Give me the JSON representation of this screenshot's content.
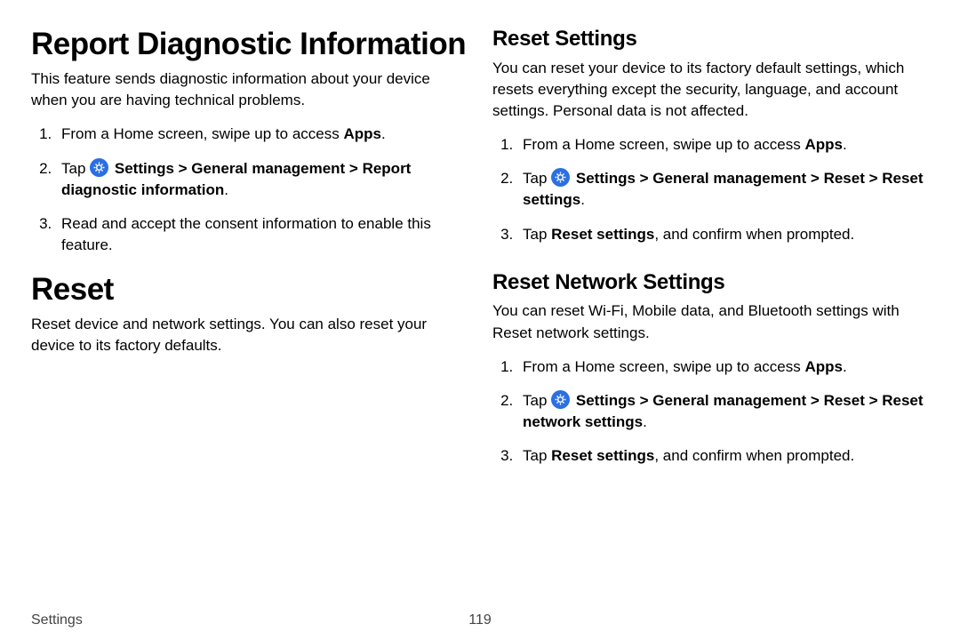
{
  "left": {
    "h1": "Report Diagnostic Information",
    "intro": "This feature sends diagnostic information about your device when you are having technical problems.",
    "steps": {
      "s1_pre": "From a Home screen, swipe up to access ",
      "s1_bold": "Apps",
      "s1_post": ".",
      "s2_pre": "Tap ",
      "s2_path": " Settings > General management > Report diagnostic information",
      "s2_post": ".",
      "s3": "Read and accept the consent information to enable this feature."
    },
    "h1b": "Reset",
    "reset_intro": "Reset device and network settings. You can also reset your device to its factory defaults."
  },
  "right": {
    "h2a": "Reset Settings",
    "a_intro": "You can reset your device to its factory default settings, which resets everything except the security, language, and account settings. Personal data is not affected.",
    "a_s1_pre": "From a Home screen, swipe up to access ",
    "a_s1_bold": "Apps",
    "a_s1_post": ".",
    "a_s2_pre": "Tap ",
    "a_s2_path": " Settings > General management > Reset > Reset settings",
    "a_s2_post": ".",
    "a_s3_pre": "Tap ",
    "a_s3_bold": "Reset settings",
    "a_s3_post": ", and confirm when prompted.",
    "h2b": "Reset Network Settings",
    "b_intro": "You can reset Wi-Fi, Mobile data, and Bluetooth settings with Reset network settings.",
    "b_s1_pre": "From a Home screen, swipe up to access ",
    "b_s1_bold": "Apps",
    "b_s1_post": ".",
    "b_s2_pre": "Tap ",
    "b_s2_path": " Settings > General management > Reset > Reset network settings",
    "b_s2_post": ".",
    "b_s3_pre": "Tap ",
    "b_s3_bold": "Reset settings",
    "b_s3_post": ", and confirm when prompted."
  },
  "footer": {
    "section": "Settings",
    "page": "119"
  }
}
